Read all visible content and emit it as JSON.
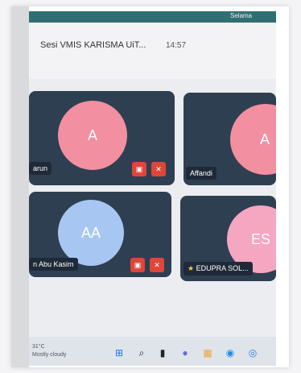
{
  "window": {
    "title": "Sesi VMIS KARISMA UiT...",
    "time": "14:57"
  },
  "status_strip": {
    "text": "Selama"
  },
  "participants": [
    {
      "initials": "A",
      "name": "arun",
      "avatar_color": "#f28fa0",
      "camera_off": true,
      "mic_off": true
    },
    {
      "initials": "A",
      "name": "Affandi",
      "avatar_color": "#f28fa0"
    },
    {
      "initials": "AA",
      "name": "n Abu Kasim",
      "avatar_color": "#a7c7f2",
      "camera_off": true,
      "mic_off": true
    },
    {
      "initials": "ES",
      "name": "EDUPRA SOL...",
      "avatar_color": "#f5a6c0",
      "starred": true
    }
  ],
  "taskbar": {
    "weather_temp": "31°C",
    "weather_desc": "Mostly cloudy",
    "icons": [
      "windows-start-icon",
      "search-icon",
      "task-view-icon",
      "chat-icon",
      "file-explorer-icon",
      "edge-icon",
      "teams-icon"
    ]
  },
  "colors": {
    "tile_bg": "#2f3f52",
    "button_red": "#e0453a",
    "accent_teal": "#2f6f73"
  }
}
